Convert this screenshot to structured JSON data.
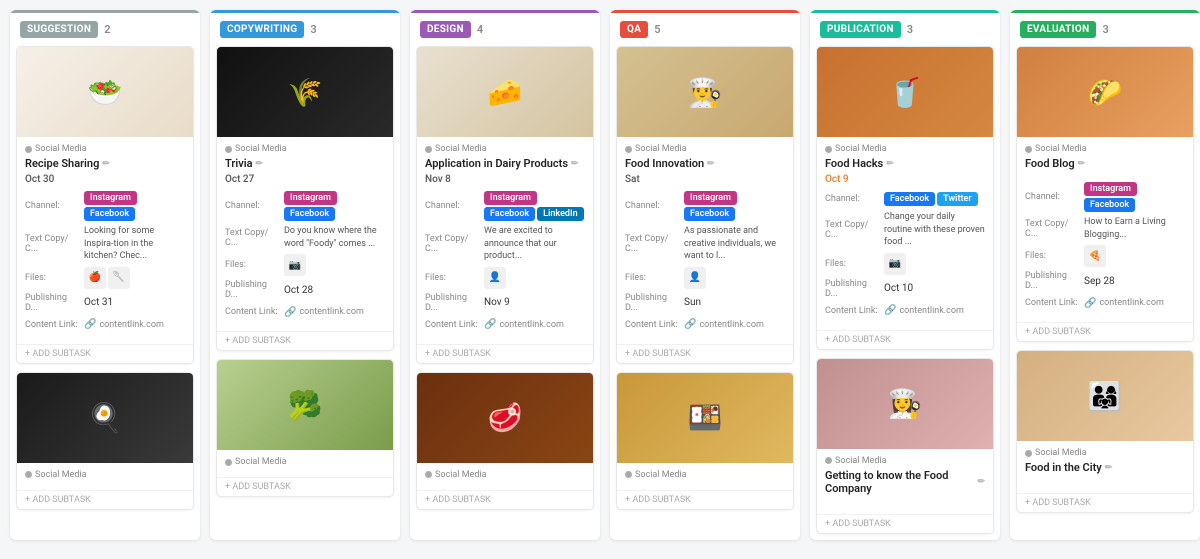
{
  "columns": [
    {
      "id": "suggestion",
      "label": "SUGGESTION",
      "labelClass": "label-suggestion",
      "colClass": "col-suggestion",
      "count": "2",
      "cards": [
        {
          "imageEmoji": "🥗",
          "imageBg": "#f5f0e8",
          "imageGradient": "linear-gradient(135deg, #f5f0e8, #e8dcc8)",
          "category": "Social Media",
          "title": "Recipe Sharing",
          "date": "Oct 30",
          "dateOrange": false,
          "channels": [
            "Instagram",
            "Facebook"
          ],
          "textLabel": "Text Copy/ C...",
          "textPreview": "Looking for some Inspira-tion in the kitchen? Chec...",
          "files": [
            "🍎",
            "🥄"
          ],
          "publishLabel": "Publishing D...",
          "publishDate": "Oct 31",
          "publishOrange": false,
          "contentLink": "contentlink.com"
        },
        {
          "imageEmoji": "🍳",
          "imageBg": "#2a2a2a",
          "imageGradient": "linear-gradient(135deg, #1a1a1a, #3a3a3a)",
          "imageSecondCard": true,
          "category": "Social Media",
          "title": "",
          "date": "",
          "dateOrange": false,
          "channels": [],
          "textLabel": "",
          "textPreview": "",
          "files": [],
          "publishLabel": "",
          "publishDate": "",
          "publishOrange": false,
          "contentLink": ""
        }
      ]
    },
    {
      "id": "copywriting",
      "label": "COPYWRITING",
      "labelClass": "label-copywriting",
      "colClass": "col-copywriting",
      "count": "3",
      "cards": [
        {
          "imageEmoji": "🌾",
          "imageBg": "#1a1a1a",
          "imageGradient": "linear-gradient(135deg, #111, #2a2a2a)",
          "category": "Social Media",
          "title": "Trivia",
          "date": "Oct 27",
          "dateOrange": false,
          "channels": [
            "Instagram",
            "Facebook"
          ],
          "textLabel": "Text Copy/ C...",
          "textPreview": "Do you know where the word \"Foody\" comes ...",
          "files": [
            "📷"
          ],
          "publishLabel": "Publishing D...",
          "publishDate": "Oct 28",
          "publishOrange": false,
          "contentLink": "contentlink.com"
        },
        {
          "imageEmoji": "🥦",
          "imageBg": "#c8d8a0",
          "imageGradient": "linear-gradient(135deg, #b8d090, #7a9c4a)",
          "imageSecondCard": true,
          "category": "Social Media",
          "title": "",
          "date": "",
          "dateOrange": false,
          "channels": [],
          "textLabel": "",
          "textPreview": "",
          "files": [],
          "publishLabel": "",
          "publishDate": "",
          "publishOrange": false,
          "contentLink": ""
        }
      ]
    },
    {
      "id": "design",
      "label": "DESIGN",
      "labelClass": "label-design",
      "colClass": "col-design",
      "count": "4",
      "cards": [
        {
          "imageEmoji": "🧀",
          "imageBg": "#e8e0d0",
          "imageGradient": "linear-gradient(135deg, #e8e0d0, #d4c4a0)",
          "category": "Social Media",
          "title": "Application in Dairy Products",
          "date": "Nov 8",
          "dateOrange": false,
          "channels": [
            "Instagram",
            "Facebook",
            "LinkedIn"
          ],
          "textLabel": "Text Copy/ C...",
          "textPreview": "We are excited to announce that our product...",
          "files": [
            "👤"
          ],
          "publishLabel": "Publishing D...",
          "publishDate": "Nov 9",
          "publishOrange": false,
          "contentLink": "contentlink.com"
        },
        {
          "imageEmoji": "🥩",
          "imageBg": "#8B4513",
          "imageGradient": "linear-gradient(135deg, #6B3010, #8B4513)",
          "imageSecondCard": true,
          "category": "Social Media",
          "title": "",
          "date": "",
          "dateOrange": false,
          "channels": [],
          "textLabel": "",
          "textPreview": "",
          "files": [],
          "publishLabel": "",
          "publishDate": "",
          "publishOrange": false,
          "contentLink": ""
        }
      ]
    },
    {
      "id": "qa",
      "label": "QA",
      "labelClass": "label-qa",
      "colClass": "col-qa",
      "count": "5",
      "cards": [
        {
          "imageEmoji": "👨‍🍳",
          "imageBg": "#e8d4b0",
          "imageGradient": "linear-gradient(135deg, #d4c090, #c8a870)",
          "category": "Social Media",
          "title": "Food Innovation",
          "date": "Sat",
          "dateOrange": false,
          "channels": [
            "Instagram",
            "Facebook"
          ],
          "textLabel": "Text Copy/ C...",
          "textPreview": "As passionate and creative individuals, we want to l...",
          "files": [
            "👤"
          ],
          "publishLabel": "Publishing D...",
          "publishDate": "Sun",
          "publishOrange": false,
          "contentLink": "contentlink.com"
        },
        {
          "imageEmoji": "🍱",
          "imageBg": "#d4a853",
          "imageGradient": "linear-gradient(135deg, #c8983a, #e0b860)",
          "imageSecondCard": true,
          "category": "Social Media",
          "title": "",
          "date": "",
          "dateOrange": false,
          "channels": [],
          "textLabel": "",
          "textPreview": "",
          "files": [],
          "publishLabel": "",
          "publishDate": "",
          "publishOrange": false,
          "contentLink": ""
        }
      ]
    },
    {
      "id": "publication",
      "label": "PUBLICATION",
      "labelClass": "label-publication",
      "colClass": "col-publication",
      "count": "3",
      "cards": [
        {
          "imageEmoji": "🥤",
          "imageBg": "#e8c070",
          "imageGradient": "linear-gradient(135deg, #c87030, #d48840)",
          "category": "Social Media",
          "title": "Food Hacks",
          "date": "Oct 9",
          "dateOrange": true,
          "channels": [
            "Facebook",
            "Twitter"
          ],
          "textLabel": "Text Copy/ C...",
          "textPreview": "Change your daily routine with these proven food ...",
          "files": [
            "📷"
          ],
          "publishLabel": "Publishing D...",
          "publishDate": "Oct 10",
          "publishOrange": false,
          "contentLink": "contentlink.com"
        },
        {
          "imageEmoji": "👩‍🍳",
          "imageBg": "#d4a0a0",
          "imageGradient": "linear-gradient(135deg, #c09090, #e0b0b0)",
          "imageSecondCard": true,
          "category": "Social Media",
          "title": "Getting to know the Food Company",
          "date": "",
          "dateOrange": false,
          "channels": [],
          "textLabel": "",
          "textPreview": "",
          "files": [],
          "publishLabel": "",
          "publishDate": "",
          "publishOrange": false,
          "contentLink": ""
        }
      ]
    },
    {
      "id": "evaluation",
      "label": "EVALUATION",
      "labelClass": "label-evaluation",
      "colClass": "col-evaluation",
      "count": "3",
      "cards": [
        {
          "imageEmoji": "🌮",
          "imageBg": "#e8a060",
          "imageGradient": "linear-gradient(135deg, #d08040, #e8a060)",
          "category": "Social Media",
          "title": "Food Blog",
          "date": "",
          "dateOrange": false,
          "channels": [
            "Instagram",
            "Facebook"
          ],
          "textLabel": "Text Copy/ C...",
          "textPreview": "How to Earn a Living Blogging...",
          "files": [
            "🍕"
          ],
          "publishLabel": "Publishing D...",
          "publishDate": "Sep 28",
          "publishOrange": false,
          "contentLink": "contentlink.com"
        },
        {
          "imageEmoji": "👨‍👩‍👧",
          "imageBg": "#e8c8a0",
          "imageGradient": "linear-gradient(135deg, #d4b080, #e8c8a0)",
          "imageSecondCard": true,
          "category": "Social Media",
          "title": "Food in the City",
          "date": "",
          "dateOrange": false,
          "channels": [],
          "textLabel": "",
          "textPreview": "",
          "files": [],
          "publishLabel": "",
          "publishDate": "",
          "publishOrange": false,
          "contentLink": ""
        }
      ]
    }
  ],
  "addSubtask": "+ ADD SUBTASK",
  "labels": {
    "channel": "Channel:",
    "textCopy": "Text Copy/ C...",
    "files": "Files:",
    "publishing": "Publishing D...",
    "contentLink": "Content Link:",
    "socialMedia": "Social Media"
  }
}
